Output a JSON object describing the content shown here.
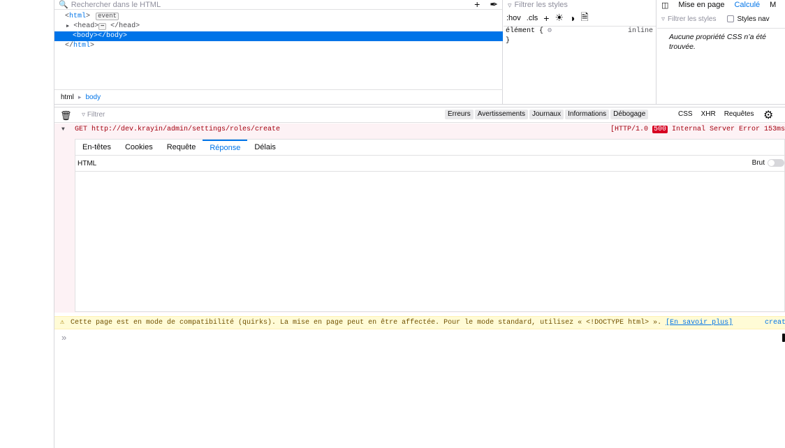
{
  "markup": {
    "search_placeholder": "Rechercher dans le HTML",
    "tree": {
      "html_open_tag": "html",
      "event_badge": "event",
      "head_tag": "head",
      "head_ellipsis": "⋯",
      "head_close": "</head>",
      "body_line": "<body></body>",
      "html_close_tag": "html"
    },
    "breadcrumbs": [
      "html",
      "body"
    ]
  },
  "rules": {
    "filter_placeholder": "Filtrer les styles",
    "toolbar": {
      "hov": ":hov",
      "cls": ".cls"
    },
    "element_selector": "élément {",
    "element_close": "}",
    "inline_label": "inline"
  },
  "computed": {
    "tabs": [
      "Mise en page",
      "Calculé",
      "M"
    ],
    "filter_placeholder": "Filtrer les styles",
    "browser_styles_label": "Styles nav",
    "empty_message": "Aucune propriété CSS n’a été trouvée."
  },
  "console": {
    "filter_placeholder": "Filtrer",
    "levels": [
      "Erreurs",
      "Avertissements",
      "Journaux",
      "Informations",
      "Débogage"
    ],
    "types": [
      "CSS",
      "XHR",
      "Requêtes"
    ],
    "request": {
      "method_url": "GET http://dev.krayin/admin/settings/roles/create",
      "status_prefix": "[HTTP/1.0 ",
      "status_code": "500",
      "status_suffix": " Internal Server Error 153ms",
      "tabs": [
        "En-têtes",
        "Cookies",
        "Requête",
        "Réponse",
        "Délais"
      ],
      "active_tab": "Réponse",
      "sub_label": "HTML",
      "raw_label": "Brut"
    },
    "warning": {
      "message": "Cette page est en mode de compatibilité (quirks). La mise en page peut en être affectée. Pour le mode standard, utilisez « <!DOCTYPE html> ».",
      "link": "[En savoir plus]",
      "source": "creat"
    },
    "prompt_symbol": "»"
  },
  "colors": {
    "accent": "#0074e8",
    "error_bg": "#fdf2f5",
    "error_text": "#a4000f",
    "warning_bg": "#fffbd6"
  }
}
